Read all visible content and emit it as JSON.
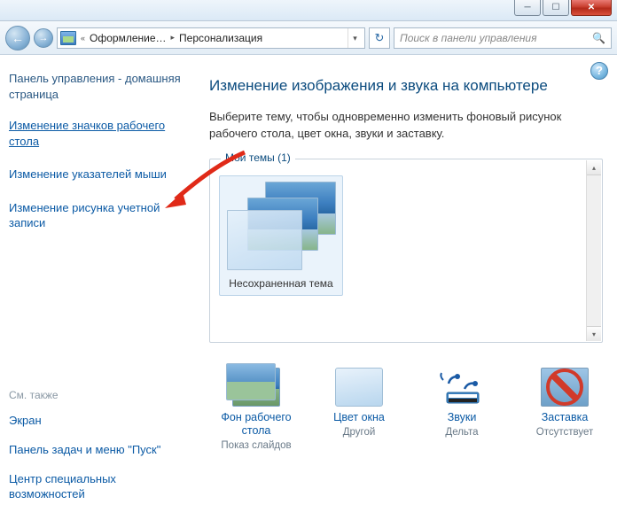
{
  "breadcrumb": {
    "seg1": "Оформление…",
    "seg2": "Персонализация"
  },
  "search": {
    "placeholder": "Поиск в панели управления"
  },
  "sidebar": {
    "heading": "Панель управления - домашняя страница",
    "links": [
      "Изменение значков рабочего стола",
      "Изменение указателей мыши",
      "Изменение рисунка учетной записи"
    ],
    "see_also": "См. также",
    "footer": [
      "Экран",
      "Панель задач и меню \"Пуск\"",
      "Центр специальных возможностей"
    ]
  },
  "main": {
    "title": "Изменение изображения и звука на компьютере",
    "desc": "Выберите тему, чтобы одновременно изменить фоновый рисунок рабочего стола, цвет окна, звуки и заставку.",
    "themes_legend": "Мои темы (1)",
    "theme_name": "Несохраненная тема"
  },
  "bottom": {
    "items": [
      {
        "title": "Фон рабочего стола",
        "sub": "Показ слайдов"
      },
      {
        "title": "Цвет окна",
        "sub": "Другой"
      },
      {
        "title": "Звуки",
        "sub": "Дельта"
      },
      {
        "title": "Заставка",
        "sub": "Отсутствует"
      }
    ]
  }
}
